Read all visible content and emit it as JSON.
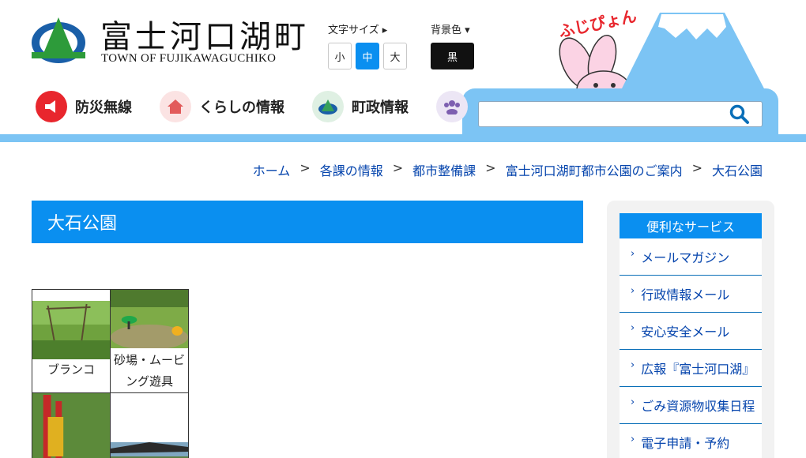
{
  "header": {
    "title": "富士河口湖町",
    "subtitle": "TOWN OF FUJIKAWAGUCHIKO",
    "font_size": {
      "label": "文字サイズ",
      "small": "小",
      "medium": "中",
      "large": "大"
    },
    "background": {
      "label": "背景色",
      "black": "黒"
    },
    "mascot_text": "ふじぴょん"
  },
  "nav": [
    {
      "label": "防災無線",
      "icon": "megaphone-icon",
      "color": "#e8262d"
    },
    {
      "label": "くらしの情報",
      "icon": "house-icon",
      "color": "#e25a5a"
    },
    {
      "label": "町政情報",
      "icon": "mountain-icon",
      "color": "#36a05a"
    },
    {
      "label": "",
      "icon": "people-icon",
      "color": "#7d5fb0"
    }
  ],
  "search": {
    "placeholder": ""
  },
  "breadcrumb": [
    "ホーム",
    "各課の情報",
    "都市整備課",
    "富士河口湖町都市公園のご案内",
    "大石公園"
  ],
  "breadcrumb_sep": ">",
  "main": {
    "page_title": "大石公園",
    "photos": [
      {
        "caption": "ブランコ"
      },
      {
        "caption_line1": "砂場・ムービ",
        "caption_line2": "ング遊具"
      }
    ]
  },
  "sidebar": {
    "heading": "便利なサービス",
    "items": [
      "メールマガジン",
      "行政情報メール",
      "安心安全メール",
      "広報『富士河口湖』",
      "ごみ資源物収集日程",
      "電子申請・予約"
    ]
  },
  "colors": {
    "accent": "#0a8ff0",
    "bar": "#7cc4f4",
    "link": "#0645ad"
  }
}
